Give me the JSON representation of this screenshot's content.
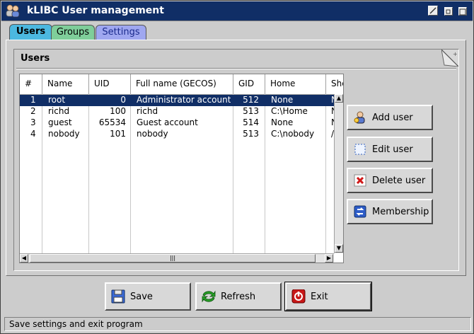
{
  "window": {
    "title": "kLIBC User management",
    "title_bar_color": "#102e66"
  },
  "tabs": [
    {
      "label": "Users",
      "active": true,
      "color": "#4cb8e0"
    },
    {
      "label": "Groups",
      "active": false,
      "color": "#7fce9a"
    },
    {
      "label": "Settings",
      "active": false,
      "color": "#9fa7f0"
    }
  ],
  "users_group": {
    "title": "Users"
  },
  "table": {
    "columns": [
      "#",
      "Name",
      "UID",
      "Full name (GECOS)",
      "GID",
      "Home",
      "She"
    ],
    "rows": [
      {
        "num": "1",
        "name": "root",
        "uid": "0",
        "gecos": "Administrator account",
        "gid": "512",
        "home": "None",
        "shell": "N",
        "selected": true
      },
      {
        "num": "2",
        "name": "richd",
        "uid": "100",
        "gecos": "richd",
        "gid": "513",
        "home": "C:\\Home",
        "shell": "N",
        "selected": false
      },
      {
        "num": "3",
        "name": "guest",
        "uid": "65534",
        "gecos": "Guest account",
        "gid": "514",
        "home": "None",
        "shell": "N",
        "selected": false
      },
      {
        "num": "4",
        "name": "nobody",
        "uid": "101",
        "gecos": "nobody",
        "gid": "513",
        "home": "C:\\nobody",
        "shell": "/",
        "selected": false
      }
    ],
    "selection_color": "#102e66"
  },
  "side_buttons": [
    {
      "label": "Add user",
      "icon": "add-user-icon"
    },
    {
      "label": "Edit user",
      "icon": "edit-user-icon"
    },
    {
      "label": "Delete user",
      "icon": "delete-user-icon"
    },
    {
      "label": "Membership",
      "icon": "membership-icon"
    }
  ],
  "bottom_buttons": {
    "save": {
      "label": "Save",
      "icon": "floppy-disk-icon"
    },
    "refresh": {
      "label": "Refresh",
      "icon": "refresh-arrows-icon"
    },
    "exit": {
      "label": "Exit",
      "icon": "power-icon"
    }
  },
  "status": {
    "text": "Save settings and exit program"
  }
}
